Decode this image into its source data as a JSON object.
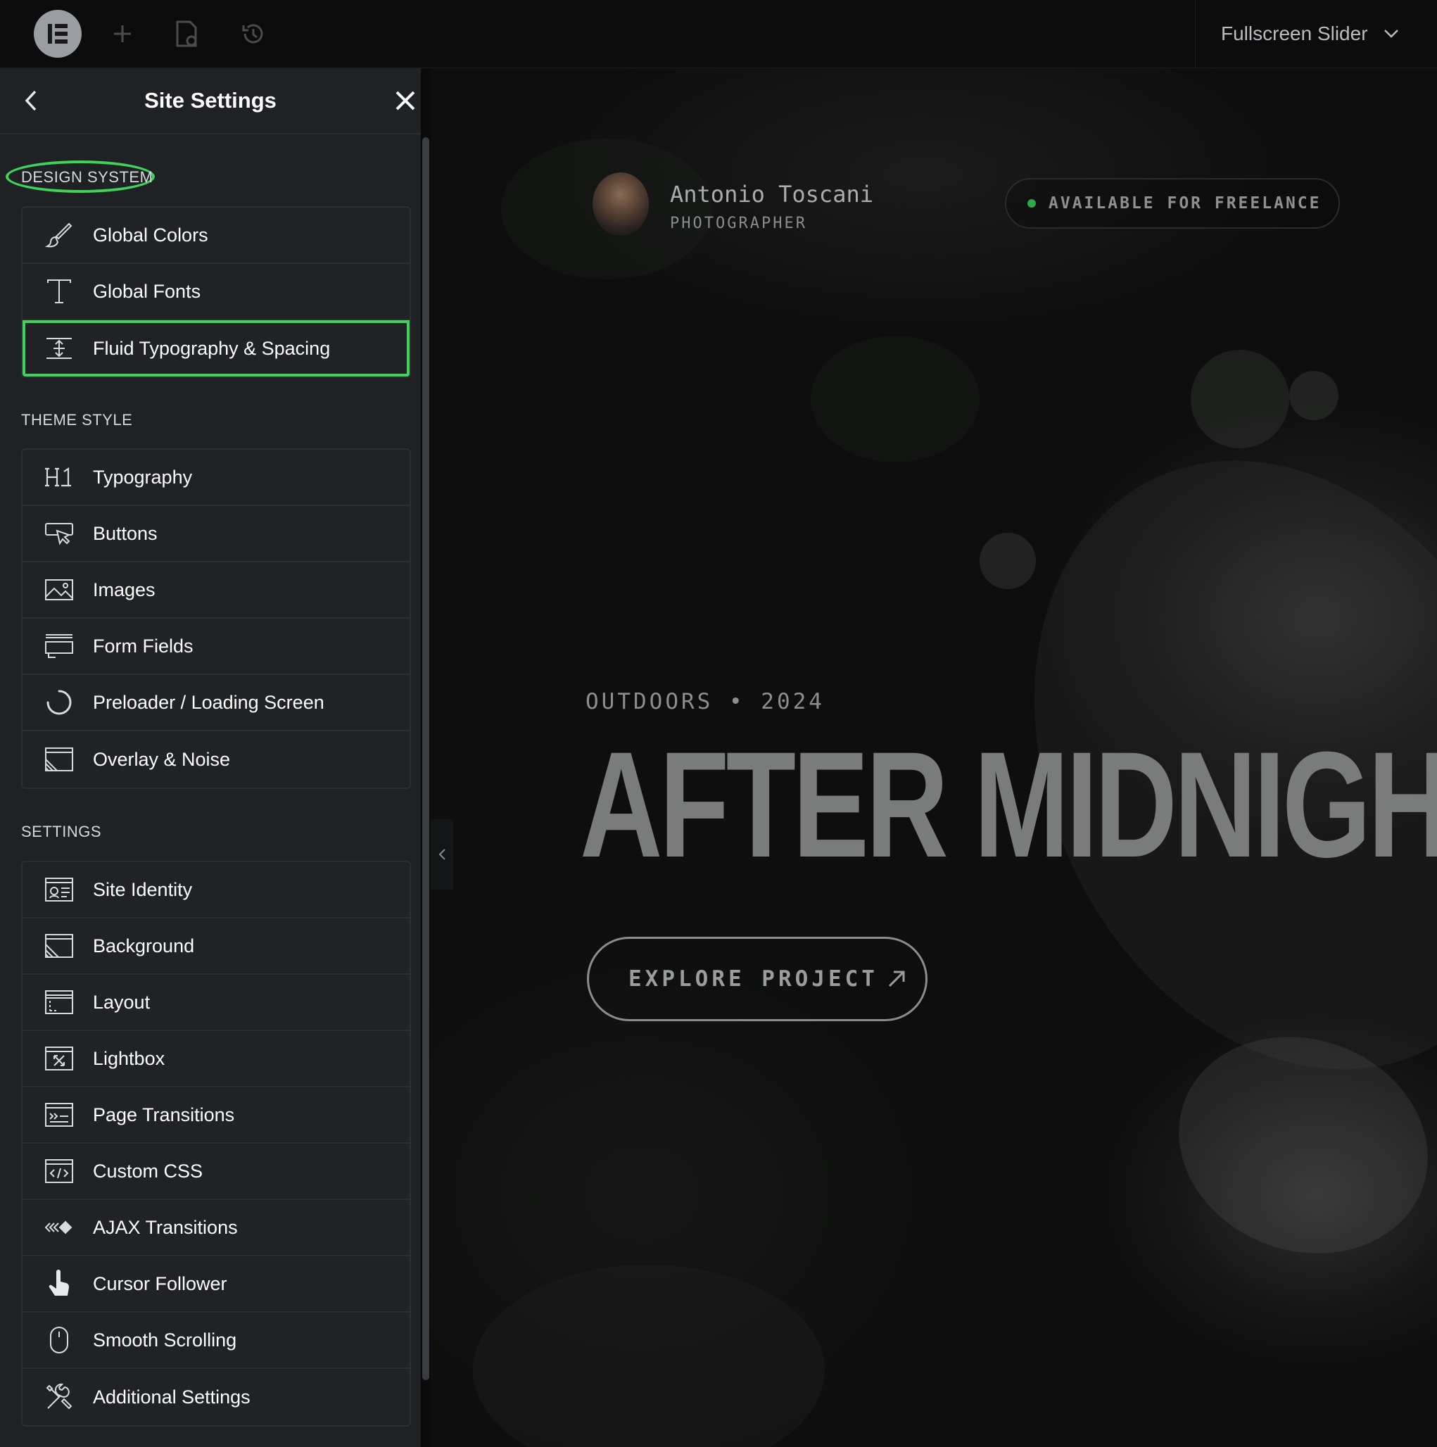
{
  "topbar": {
    "page_selector": "Fullscreen Slider",
    "icons": [
      "elementor-logo-icon",
      "add-icon",
      "page-settings-icon",
      "history-icon",
      "chevron-down-icon"
    ]
  },
  "panel": {
    "title": "Site Settings",
    "sections": [
      {
        "label": "DESIGN SYSTEM",
        "items": [
          {
            "label": "Global Colors",
            "icon": "brush-icon"
          },
          {
            "label": "Global Fonts",
            "icon": "type-icon"
          },
          {
            "label": "Fluid Typography & Spacing",
            "icon": "fluid-spacing-icon",
            "highlighted": true
          }
        ]
      },
      {
        "label": "THEME STYLE",
        "items": [
          {
            "label": "Typography",
            "icon": "heading-icon"
          },
          {
            "label": "Buttons",
            "icon": "button-cursor-icon"
          },
          {
            "label": "Images",
            "icon": "image-icon"
          },
          {
            "label": "Form Fields",
            "icon": "form-field-icon"
          },
          {
            "label": "Preloader / Loading Screen",
            "icon": "loader-icon"
          },
          {
            "label": "Overlay & Noise",
            "icon": "overlay-icon"
          }
        ]
      },
      {
        "label": "SETTINGS",
        "items": [
          {
            "label": "Site Identity",
            "icon": "id-card-icon"
          },
          {
            "label": "Background",
            "icon": "background-icon"
          },
          {
            "label": "Layout",
            "icon": "layout-icon"
          },
          {
            "label": "Lightbox",
            "icon": "lightbox-icon"
          },
          {
            "label": "Page Transitions",
            "icon": "page-transition-icon"
          },
          {
            "label": "Custom CSS",
            "icon": "code-icon"
          },
          {
            "label": "AJAX Transitions",
            "icon": "ajax-icon"
          },
          {
            "label": "Cursor Follower",
            "icon": "pointer-hand-icon"
          },
          {
            "label": "Smooth Scrolling",
            "icon": "mouse-icon"
          },
          {
            "label": "Additional Settings",
            "icon": "tools-icon"
          }
        ]
      }
    ]
  },
  "hero": {
    "name": "Antonio Toscani",
    "role": "PHOTOGRAPHER",
    "badge": "AVAILABLE FOR FREELANCE",
    "eyebrow": "OUTDOORS • 2024",
    "headline": "AFTER MIDNIGHT",
    "cta": "EXPLORE PROJECT"
  },
  "colors": {
    "highlight": "#3fd35a",
    "panel_bg": "#1f2124",
    "status_dot": "#2aa84a"
  }
}
